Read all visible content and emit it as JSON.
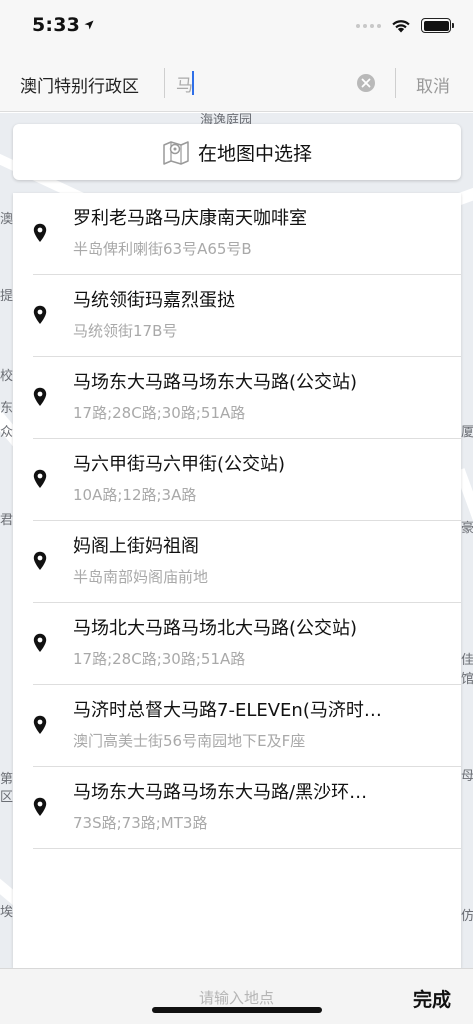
{
  "status_bar": {
    "time": "5:33"
  },
  "header": {
    "region": "澳门特别行政区",
    "search_value": "马",
    "cancel_label": "取消"
  },
  "map": {
    "labels": [
      "海逸庭园",
      "澳",
      "提",
      "校",
      "东",
      "众",
      "君",
      "第",
      "区",
      "埃",
      "厦",
      "豪",
      "佳",
      "馆",
      "母",
      "仿"
    ]
  },
  "map_select": {
    "label": "在地图中选择"
  },
  "results": [
    {
      "title": "罗利老马路马庆康南天咖啡室",
      "subtitle": "半岛俾利喇街63号A65号B"
    },
    {
      "title": "马统领街玛嘉烈蛋挞",
      "subtitle": "马统领街17B号"
    },
    {
      "title": "马场东大马路马场东大马路(公交站)",
      "subtitle": "17路;28C路;30路;51A路"
    },
    {
      "title": "马六甲街马六甲街(公交站)",
      "subtitle": "10A路;12路;3A路"
    },
    {
      "title": "妈阁上街妈祖阁",
      "subtitle": "半岛南部妈阁庙前地"
    },
    {
      "title": "马场北大马路马场北大马路(公交站)",
      "subtitle": "17路;28C路;30路;51A路"
    },
    {
      "title": "马济时总督大马路7-ELEVEn(马济时…",
      "subtitle": "澳门高美士街56号南园地下E及F座"
    },
    {
      "title": "马场东大马路马场东大马路/黑沙环…",
      "subtitle": "73S路;73路;MT3路"
    }
  ],
  "bottom_bar": {
    "placeholder": "请输入地点",
    "done_label": "完成"
  },
  "colors": {
    "accent": "#2f6fe8",
    "map_bg": "#eaedf1"
  }
}
